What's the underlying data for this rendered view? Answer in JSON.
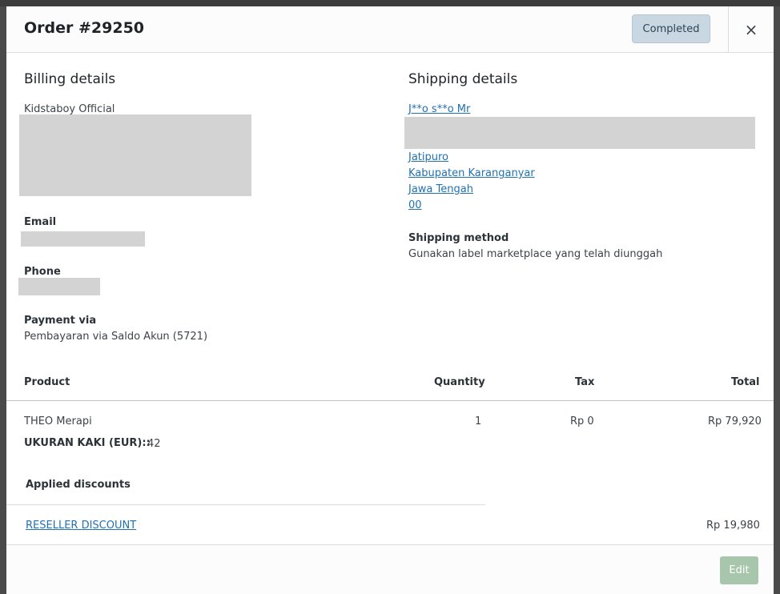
{
  "header": {
    "title": "Order #29250",
    "status": "Completed",
    "close_symbol": "×"
  },
  "billing": {
    "title": "Billing details",
    "name": "Kidstaboy Official",
    "email_label": "Email",
    "phone_label": "Phone",
    "payment_label": "Payment via",
    "payment_value": "Pembayaran via Saldo Akun (5721)"
  },
  "shipping": {
    "title": "Shipping details",
    "name": "J**o s**o Mr",
    "address_lines": [
      "Jatipuro",
      "Kabupaten Karanganyar",
      "Jawa Tengah",
      "00"
    ],
    "method_label": "Shipping method",
    "method_value": "Gunakan label marketplace yang telah diunggah"
  },
  "table": {
    "headers": {
      "product": "Product",
      "quantity": "Quantity",
      "tax": "Tax",
      "total": "Total"
    },
    "items": [
      {
        "product": "THEO Merapi",
        "meta_key": "UKURAN KAKI (EUR)::",
        "meta_value": "42",
        "quantity": "1",
        "tax": "Rp 0",
        "total": "Rp 79,920"
      }
    ],
    "discounts_label": "Applied discounts",
    "discounts": [
      {
        "name": "RESELLER DISCOUNT",
        "amount": "Rp 19,980"
      }
    ]
  },
  "footer": {
    "edit_label": "Edit"
  }
}
